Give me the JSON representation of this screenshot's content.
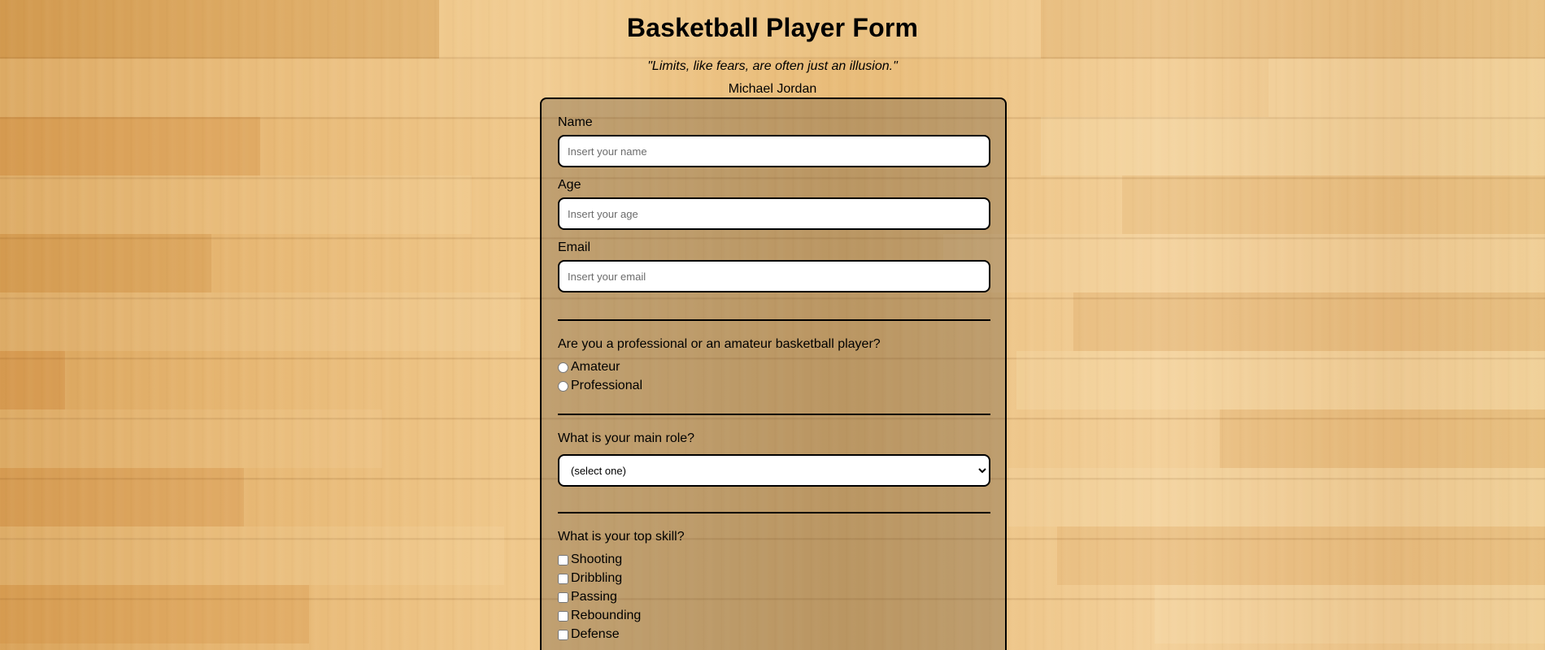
{
  "page": {
    "title": "Basketball Player Form",
    "quote": "\"Limits, like fears, are often just an illusion.\"",
    "author": "Michael Jordan"
  },
  "form": {
    "name": {
      "label": "Name",
      "placeholder": "Insert your name"
    },
    "age": {
      "label": "Age",
      "placeholder": "Insert your age"
    },
    "email": {
      "label": "Email",
      "placeholder": "Insert your email"
    },
    "level": {
      "question": "Are you a professional or an amateur basketball player?",
      "options": [
        "Amateur",
        "Professional"
      ]
    },
    "role": {
      "question": "What is your main role?",
      "selected": "(select one)"
    },
    "skills": {
      "question": "What is your top skill?",
      "options": [
        "Shooting",
        "Dribbling",
        "Passing",
        "Rebounding",
        "Defense"
      ]
    }
  },
  "colors": {
    "panel": "rgba(95,75,55,0.33)",
    "border": "#000000",
    "wood": "#e3b46f"
  }
}
